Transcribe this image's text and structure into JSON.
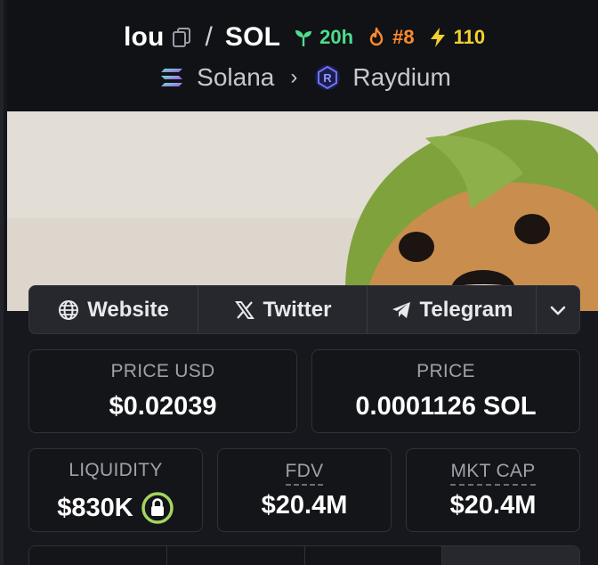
{
  "header": {
    "token": "lou",
    "quote": "SOL",
    "age": "20h",
    "rank": "#8",
    "boosts": "110",
    "chain": "Solana",
    "dex": "Raydium"
  },
  "links": {
    "website": "Website",
    "twitter": "Twitter",
    "telegram": "Telegram"
  },
  "stats": {
    "price_usd_label": "PRICE USD",
    "price_usd": "$0.02039",
    "price_label": "PRICE",
    "price_sol": "0.0001126 SOL",
    "liquidity_label": "LIQUIDITY",
    "liquidity": "$830K",
    "fdv_label": "FDV",
    "fdv": "$20.4M",
    "mktcap_label": "MKT CAP",
    "mktcap": "$20.4M"
  },
  "colors": {
    "age_green": "#4fdc8b",
    "rank_orange": "#ff8a2b",
    "boost_yellow": "#f3d02f",
    "lock_green": "#a4d65e"
  },
  "icons": [
    "copy-icon",
    "sprout-icon",
    "flame-icon",
    "lightning-icon",
    "solana-icon",
    "raydium-icon",
    "globe-icon",
    "x-icon",
    "telegram-icon",
    "chevron-down-icon",
    "lock-icon"
  ]
}
